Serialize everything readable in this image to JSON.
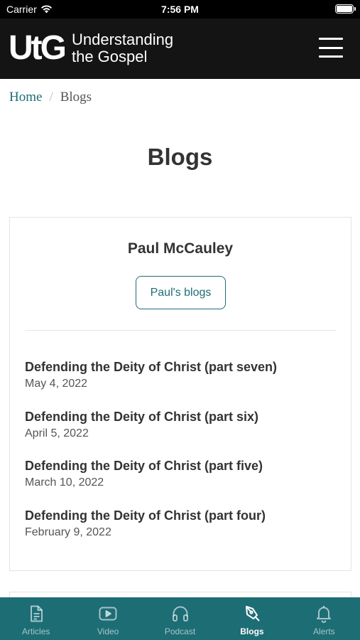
{
  "status": {
    "carrier": "Carrier",
    "time": "7:56 PM"
  },
  "header": {
    "logo": "UtG",
    "title_line1": "Understanding",
    "title_line2": "the Gospel"
  },
  "breadcrumb": {
    "home": "Home",
    "separator": "/",
    "current": "Blogs"
  },
  "page": {
    "title": "Blogs"
  },
  "author_card": {
    "name": "Paul McCauley",
    "button_label": "Paul's blogs",
    "posts": [
      {
        "title": "Defending the Deity of Christ (part seven)",
        "date": "May 4, 2022"
      },
      {
        "title": "Defending the Deity of Christ (part six)",
        "date": "April 5, 2022"
      },
      {
        "title": "Defending the Deity of Christ (part five)",
        "date": "March 10, 2022"
      },
      {
        "title": "Defending the Deity of Christ (part four)",
        "date": "February 9, 2022"
      }
    ]
  },
  "tabs": [
    {
      "label": "Articles",
      "icon": "document-icon",
      "active": false
    },
    {
      "label": "Video",
      "icon": "play-icon",
      "active": false
    },
    {
      "label": "Podcast",
      "icon": "headphones-icon",
      "active": false
    },
    {
      "label": "Blogs",
      "icon": "pen-icon",
      "active": true
    },
    {
      "label": "Alerts",
      "icon": "bell-icon",
      "active": false
    }
  ],
  "colors": {
    "accent": "#1d6d75",
    "header_bg": "#141414",
    "text": "#333333"
  }
}
